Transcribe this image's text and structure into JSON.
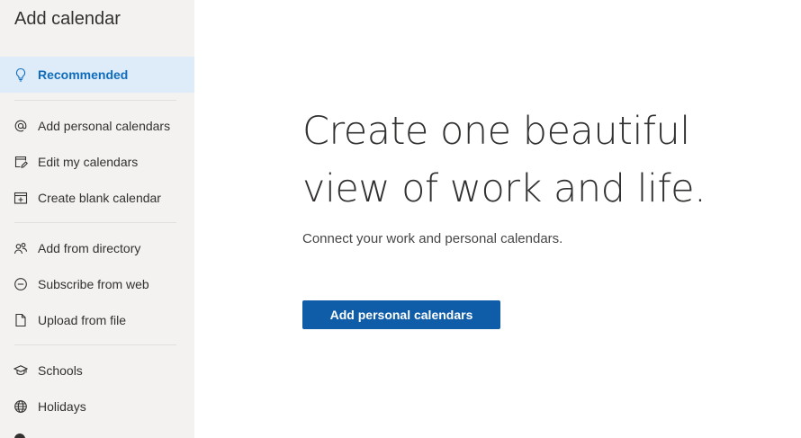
{
  "sidebar": {
    "title": "Add calendar",
    "items": [
      {
        "label": "Recommended",
        "icon": "lightbulb-icon",
        "selected": true
      },
      {
        "label": "Add personal calendars",
        "icon": "at-sign-icon"
      },
      {
        "label": "Edit my calendars",
        "icon": "edit-calendar-icon"
      },
      {
        "label": "Create blank calendar",
        "icon": "calendar-add-icon"
      },
      {
        "label": "Add from directory",
        "icon": "people-icon"
      },
      {
        "label": "Subscribe from web",
        "icon": "link-circle-icon"
      },
      {
        "label": "Upload from file",
        "icon": "document-icon"
      },
      {
        "label": "Schools",
        "icon": "graduation-cap-icon"
      },
      {
        "label": "Holidays",
        "icon": "globe-icon"
      }
    ]
  },
  "main": {
    "headline_line1": "Create one beautiful",
    "headline_line2": "view of work and life.",
    "subtext": "Connect your work and personal calendars.",
    "cta_label": "Add personal calendars"
  },
  "colors": {
    "sidebar_bg": "#f3f2f1",
    "selected_bg": "#deecf9",
    "accent": "#0f6cbd",
    "button_bg": "#0f5da8"
  }
}
